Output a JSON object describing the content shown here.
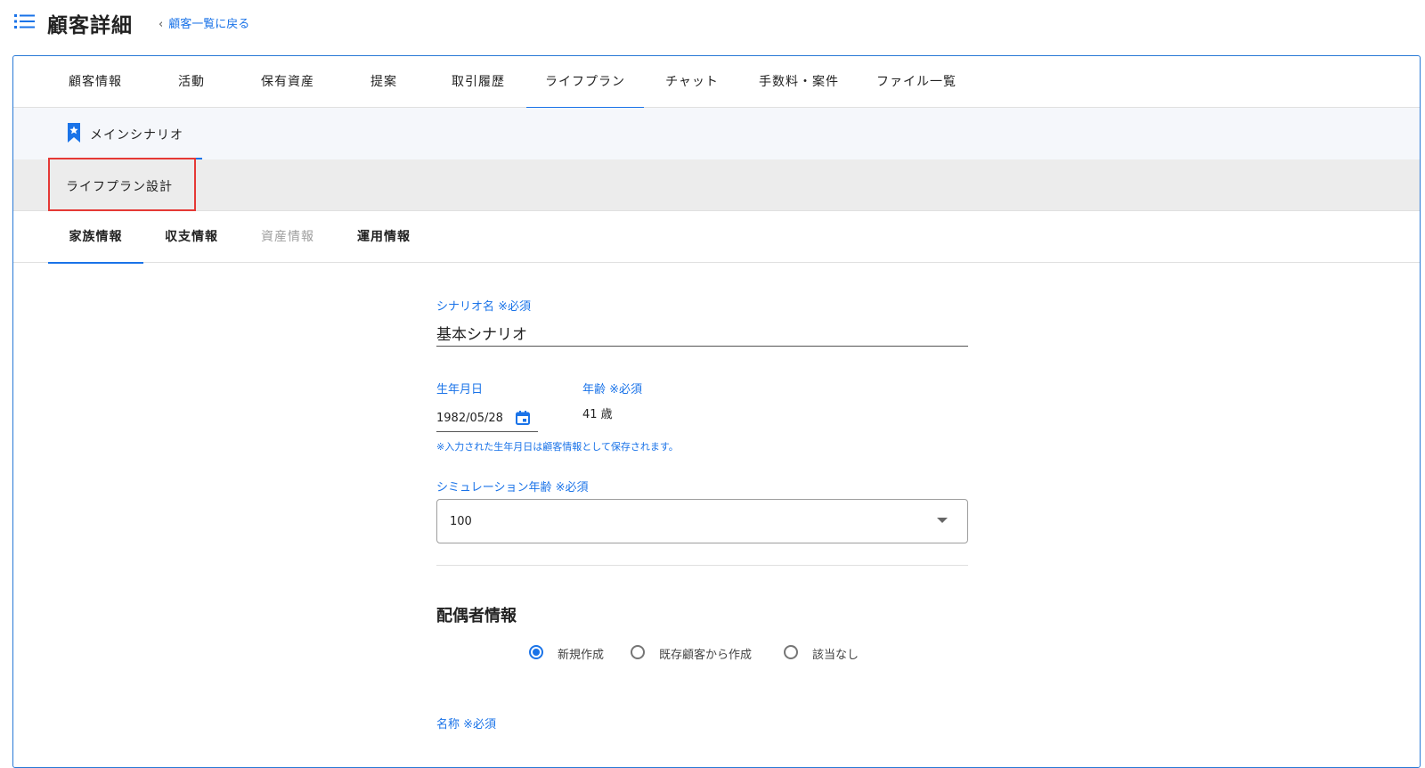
{
  "header": {
    "title": "顧客詳細",
    "back_link": "顧客一覧に戻る",
    "back_chevron": "‹"
  },
  "main_tabs": [
    {
      "label": "顧客情報"
    },
    {
      "label": "活動"
    },
    {
      "label": "保有資産"
    },
    {
      "label": "提案"
    },
    {
      "label": "取引履歴"
    },
    {
      "label": "ライフプラン",
      "active": true
    },
    {
      "label": "チャット"
    },
    {
      "label": "手数料・案件"
    },
    {
      "label": "ファイル一覧"
    }
  ],
  "scenario": {
    "label": "メインシナリオ",
    "icon": "bookmark-star-icon"
  },
  "section": {
    "life_plan_design": "ライフプラン設計"
  },
  "sub_tabs": [
    {
      "label": "家族情報",
      "active": true
    },
    {
      "label": "収支情報"
    },
    {
      "label": "資産情報",
      "disabled": true
    },
    {
      "label": "運用情報"
    }
  ],
  "form": {
    "scenario_name_label": "シナリオ名 ※必須",
    "scenario_name_value": "基本シナリオ",
    "birthdate_label": "生年月日",
    "birthdate_value": "1982/05/28",
    "age_label": "年齢 ※必須",
    "age_value": "41 歳",
    "birthdate_hint": "※入力された生年月日は顧客情報として保存されます。",
    "simulation_age_label": "シミュレーション年齢 ※必須",
    "simulation_age_value": "100",
    "spouse_section_title": "配偶者情報",
    "spouse_options": [
      {
        "label": "新規作成",
        "checked": true
      },
      {
        "label": "既存顧客から作成",
        "checked": false
      },
      {
        "label": "該当なし",
        "checked": false
      }
    ],
    "name_label": "名称 ※必須"
  },
  "colors": {
    "accent": "#1a73e8",
    "highlight_border": "#e53935",
    "card_border": "#2979d6"
  }
}
